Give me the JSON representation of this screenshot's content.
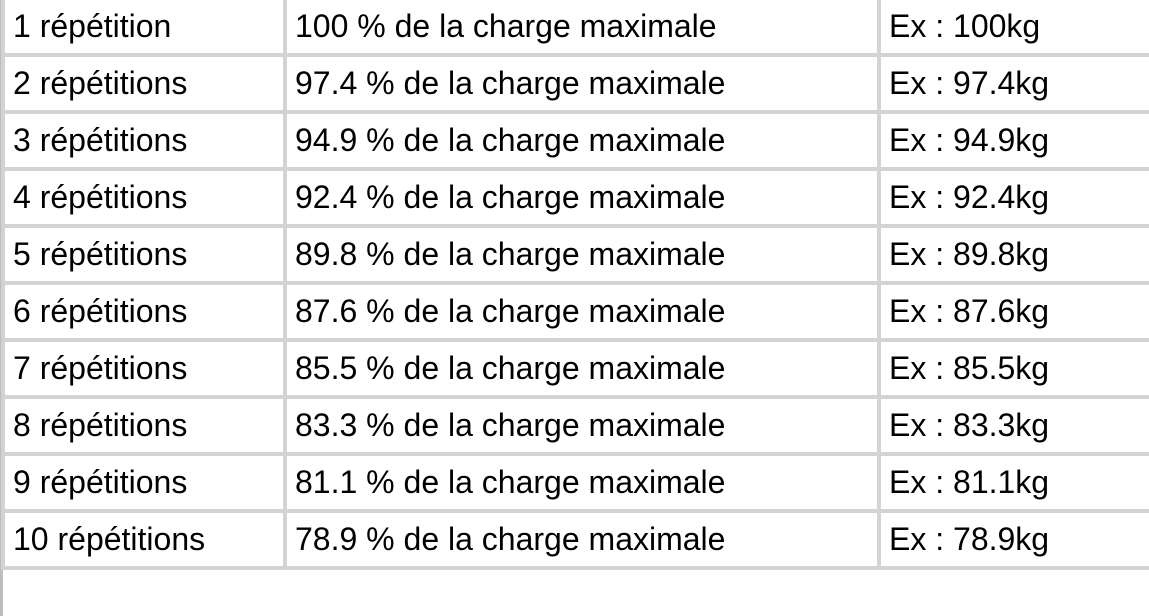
{
  "table": {
    "rows": [
      {
        "reps": "1 répétition",
        "percent": "100 % de la charge maximale",
        "example": "Ex : 100kg"
      },
      {
        "reps": "2 répétitions",
        "percent": "97.4 % de la charge maximale",
        "example": "Ex : 97.4kg"
      },
      {
        "reps": "3 répétitions",
        "percent": "94.9 % de la charge maximale",
        "example": "Ex : 94.9kg"
      },
      {
        "reps": "4 répétitions",
        "percent": "92.4 % de la charge maximale",
        "example": "Ex : 92.4kg"
      },
      {
        "reps": "5 répétitions",
        "percent": "89.8 % de la charge maximale",
        "example": "Ex : 89.8kg"
      },
      {
        "reps": "6 répétitions",
        "percent": "87.6 % de la charge maximale",
        "example": "Ex : 87.6kg"
      },
      {
        "reps": "7 répétitions",
        "percent": "85.5 % de la charge maximale",
        "example": "Ex : 85.5kg"
      },
      {
        "reps": "8 répétitions",
        "percent": "83.3 % de la charge maximale",
        "example": "Ex : 83.3kg"
      },
      {
        "reps": "9 répétitions",
        "percent": "81.1 % de la charge maximale",
        "example": "Ex : 81.1kg"
      },
      {
        "reps": "10 répétitions",
        "percent": "78.9 % de la charge maximale",
        "example": "Ex : 78.9kg"
      }
    ]
  },
  "colors": {
    "border": "#d3d3d3",
    "text": "#000000",
    "background": "#ffffff"
  }
}
